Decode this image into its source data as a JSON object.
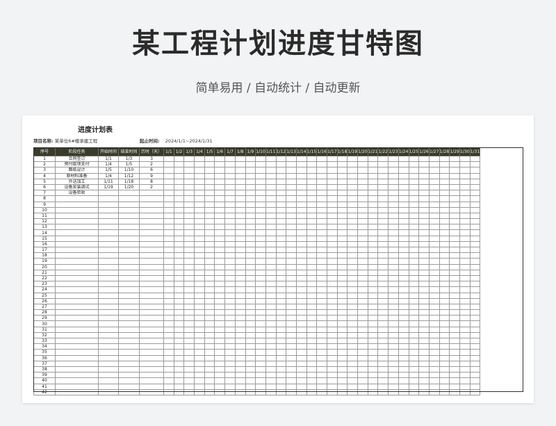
{
  "header": {
    "title": "某工程计划进度甘特图",
    "subtitle": "简单易用 / 自动统计 / 自动更新"
  },
  "sheet": {
    "title": "进度计划表",
    "project_label": "项目名称:",
    "project_value": "某单位6#楼承建工程",
    "period_label": "起止时间:",
    "period_value": "2024/1/1~2024/1/31"
  },
  "table": {
    "headers": [
      "序号",
      "阶段任务",
      "开始时间",
      "结束时间",
      "历时（天）"
    ],
    "dates": [
      "1/1",
      "1/2",
      "1/3",
      "1/4",
      "1/5",
      "1/6",
      "1/7",
      "1/8",
      "1/9",
      "1/10",
      "1/11",
      "1/12",
      "1/13",
      "1/14",
      "1/15",
      "1/16",
      "1/17",
      "1/18",
      "1/19",
      "1/20",
      "1/21",
      "1/22",
      "1/23",
      "1/24",
      "1/25",
      "1/26",
      "1/27",
      "1/28",
      "1/29",
      "1/30",
      "1/31"
    ],
    "tasks": [
      {
        "task": "合同签订",
        "start": "1/1",
        "end": "1/3",
        "days": "3"
      },
      {
        "task": "预付款项支付",
        "start": "1/4",
        "end": "1/5",
        "days": "2"
      },
      {
        "task": "图纸设计",
        "start": "1/5",
        "end": "1/10",
        "days": "6"
      },
      {
        "task": "原材料准备",
        "start": "1/4",
        "end": "1/12",
        "days": "9"
      },
      {
        "task": "外送加工",
        "start": "1/11",
        "end": "1/18",
        "days": "8"
      },
      {
        "task": "设备安装调试",
        "start": "1/19",
        "end": "1/20",
        "days": "2"
      },
      {
        "task": "设备验收",
        "start": "",
        "end": "",
        "days": ""
      }
    ],
    "row_count": 42
  }
}
